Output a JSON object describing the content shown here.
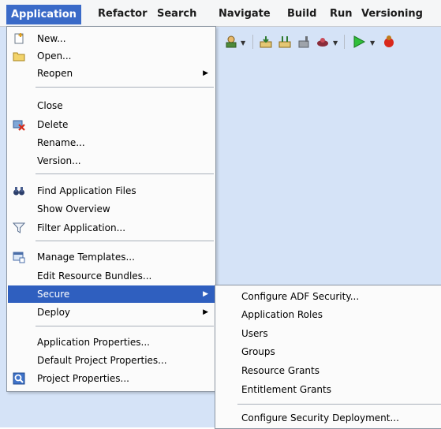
{
  "menubar": {
    "items": [
      "Application",
      "Refactor",
      "Search",
      "Navigate",
      "Build",
      "Run",
      "Versioning"
    ]
  },
  "menu": {
    "new": "New...",
    "open": "Open...",
    "reopen": "Reopen",
    "close": "Close",
    "delete": "Delete",
    "rename": "Rename...",
    "version": "Version...",
    "find_app_files": "Find Application Files",
    "show_overview": "Show Overview",
    "filter_app": "Filter Application...",
    "manage_templates": "Manage Templates...",
    "edit_resource_bundles": "Edit Resource Bundles...",
    "secure": "Secure",
    "deploy": "Deploy",
    "app_properties": "Application Properties...",
    "default_project_properties": "Default Project Properties...",
    "project_properties": "Project Properties..."
  },
  "submenu": {
    "configure_adf_security": "Configure ADF Security...",
    "application_roles": "Application Roles",
    "users": "Users",
    "groups": "Groups",
    "resource_grants": "Resource Grants",
    "entitlement_grants": "Entitlement Grants",
    "configure_security_deployment": "Configure Security Deployment..."
  },
  "icons": {
    "new": "new-file-icon",
    "open": "folder-open-icon",
    "delete": "delete-icon",
    "find": "binoculars-icon",
    "filter": "filter-funnel-icon",
    "templates": "templates-icon",
    "project_properties": "project-properties-icon",
    "submenu_arrow": "chevron-right-icon"
  },
  "colors": {
    "menubar_active": "#3a6ac8",
    "highlight": "#2f5fbf",
    "workspace": "#d5e3f7"
  }
}
